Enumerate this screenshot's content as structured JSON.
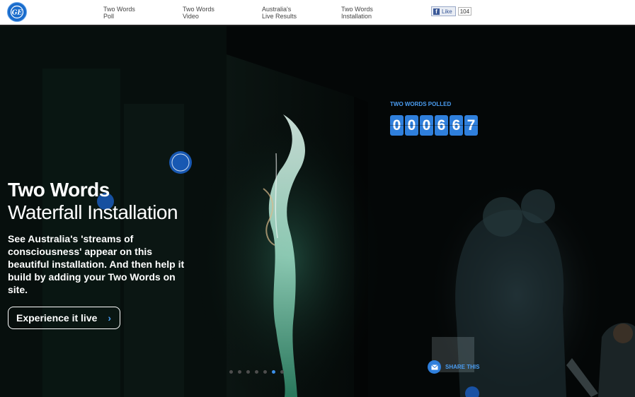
{
  "header": {
    "logo_alt": "GE",
    "nav": [
      {
        "line1": "Two Words",
        "line2": "Poll"
      },
      {
        "line1": "Two Words",
        "line2": "Video"
      },
      {
        "line1": "Australia's",
        "line2": "Live Results"
      },
      {
        "line1": "Two Words",
        "line2": "Installation"
      }
    ],
    "facebook": {
      "icon": "facebook-icon",
      "label": "Like",
      "count": "104"
    }
  },
  "hero": {
    "title_bold": "Two Words",
    "title_light": "Waterfall Installation",
    "description": "See Australia's 'streams of consciousness' appear on this beautiful installation. And then help it build by adding your Two Words on site.",
    "cta_label": "Experience it live",
    "cta_arrow": "›"
  },
  "poll": {
    "label": "TWO WORDS POLLED",
    "digits": [
      "0",
      "0",
      "0",
      "6",
      "6",
      "7"
    ]
  },
  "carousel": {
    "slide_count": 7,
    "active_index": 5
  },
  "share": {
    "icon": "envelope-icon",
    "label": "SHARE THIS"
  },
  "colors": {
    "accent": "#2f7fdc",
    "accent_text": "#4a9cf0",
    "ge_blue": "#1a6ccc"
  }
}
